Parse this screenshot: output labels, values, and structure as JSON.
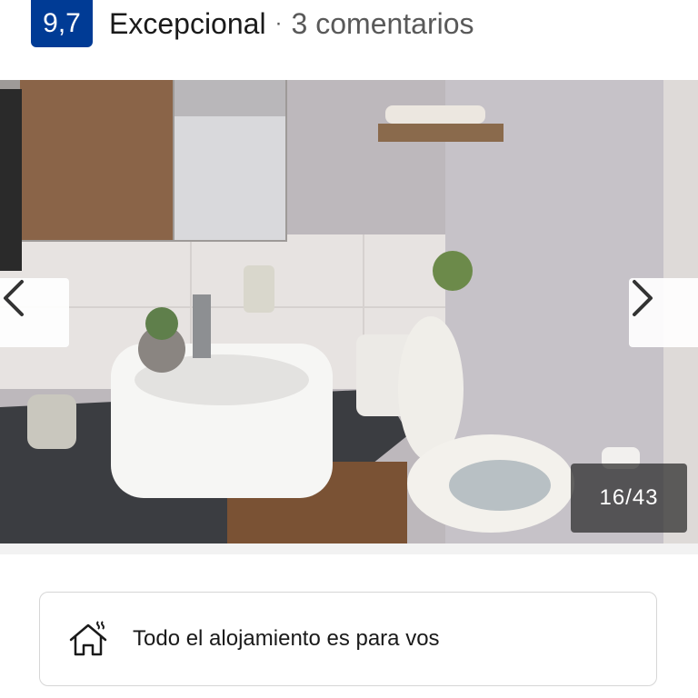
{
  "rating": {
    "score": "9,7",
    "label": "Excepcional",
    "separator": "·",
    "reviews": "3 comentarios",
    "badge_color": "#003b95"
  },
  "gallery": {
    "image_description_icon": "photo",
    "counter": "16/43",
    "prev_icon": "chevron-left-icon",
    "next_icon": "chevron-right-icon"
  },
  "info": {
    "icon": "house-icon",
    "text": "Todo el alojamiento es para vos"
  }
}
